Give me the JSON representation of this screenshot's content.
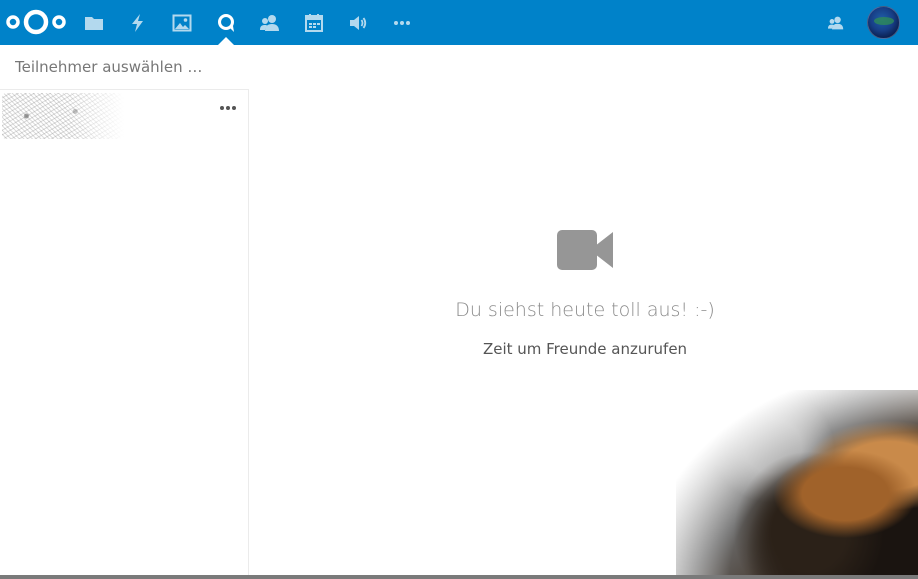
{
  "header": {
    "brand_color": "#0082c9",
    "nav": [
      {
        "name": "files",
        "icon": "folder-icon"
      },
      {
        "name": "activity",
        "icon": "lightning-icon"
      },
      {
        "name": "gallery",
        "icon": "image-icon"
      },
      {
        "name": "talk",
        "icon": "talk-icon",
        "active": true
      },
      {
        "name": "contacts",
        "icon": "contacts-icon"
      },
      {
        "name": "calendar",
        "icon": "calendar-icon"
      },
      {
        "name": "announcements",
        "icon": "speaker-icon"
      },
      {
        "name": "more",
        "icon": "more-icon"
      }
    ]
  },
  "sidebar": {
    "search_placeholder": "Teilnehmer auswählen …"
  },
  "main": {
    "empty_title": "Du siehst heute toll aus! :-)",
    "empty_subtitle": "Zeit um Freunde anzurufen"
  }
}
